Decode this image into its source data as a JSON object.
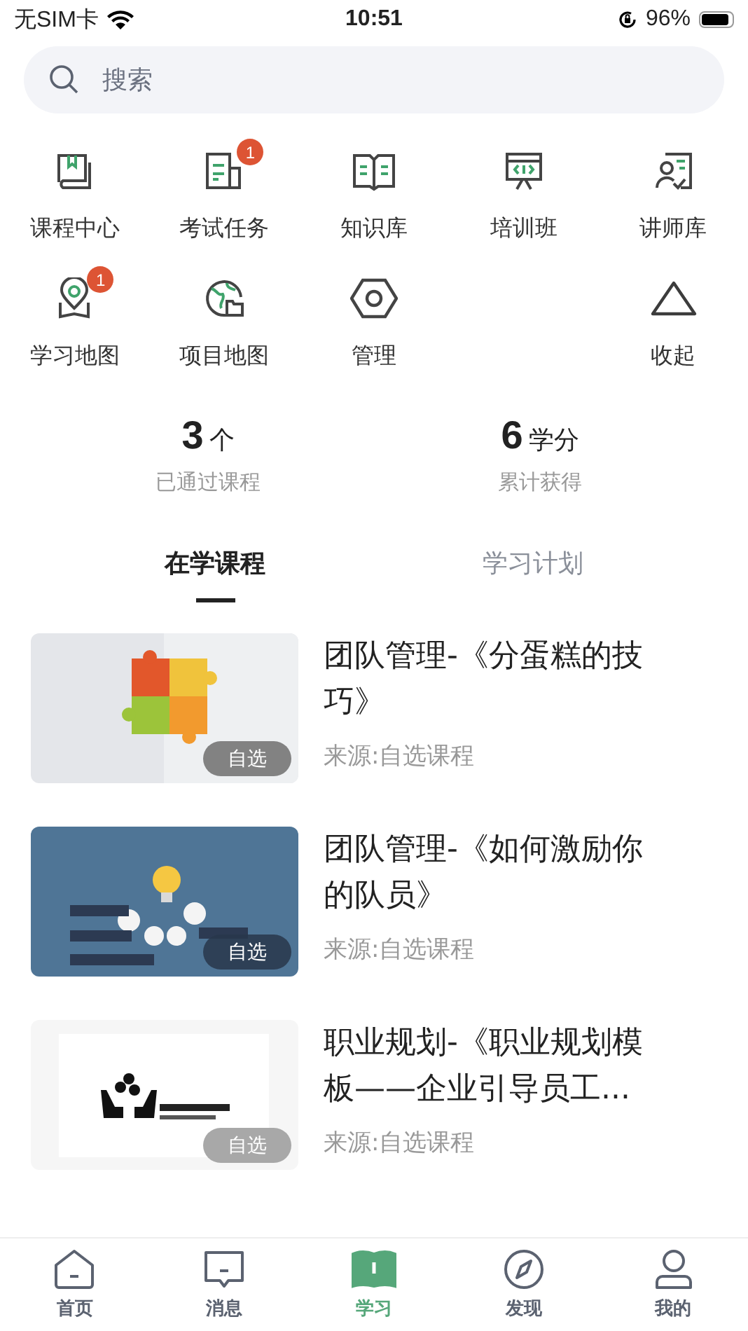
{
  "status_bar": {
    "carrier": "无SIM卡",
    "time": "10:51",
    "battery": "96%"
  },
  "search": {
    "placeholder": "搜索"
  },
  "shortcuts": [
    {
      "kind": "entry",
      "label": "课程中心"
    },
    {
      "kind": "entry",
      "label": "考试任务",
      "badge": "1"
    },
    {
      "kind": "entry",
      "label": "知识库"
    },
    {
      "kind": "entry",
      "label": "培训班"
    },
    {
      "kind": "entry",
      "label": "讲师库"
    },
    {
      "kind": "entry",
      "label": "学习地图",
      "badge": "1"
    },
    {
      "kind": "entry",
      "label": "项目地图"
    },
    {
      "kind": "entry",
      "label": "管理"
    },
    {
      "kind": "collapse",
      "label": "收起"
    }
  ],
  "stats": [
    {
      "value": "3",
      "unit": "个",
      "label": "已通过课程"
    },
    {
      "value": "6",
      "unit": "学分",
      "label": "累计获得"
    }
  ],
  "tabs": [
    {
      "label": "在学课程",
      "selected": true
    },
    {
      "label": "学习计划",
      "selected": false
    }
  ],
  "courses": [
    {
      "kind": "picture",
      "title": "团队管理-《分蛋糕的技巧》",
      "tag": "自选",
      "source": "来源:自选课程"
    },
    {
      "kind": "picture",
      "title": "团队管理-《如何激励你的队员》",
      "tag": "自选",
      "source": "来源:自选课程"
    },
    {
      "kind": "picture",
      "title": "职业规划-《职业规划模板——企业引导员工...",
      "tag": "自选",
      "source": "来源:自选课程"
    }
  ],
  "tab_bar": [
    {
      "label": "首页",
      "selected": false
    },
    {
      "label": "消息",
      "selected": false
    },
    {
      "label": "学习",
      "selected": true
    },
    {
      "label": "发现",
      "selected": false
    },
    {
      "label": "我的",
      "selected": false
    }
  ]
}
